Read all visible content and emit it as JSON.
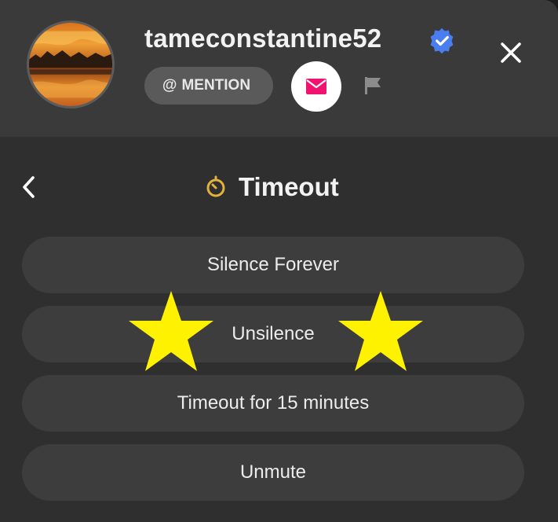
{
  "profile": {
    "username": "tameconstantine52",
    "verified_icon": "verified-badge-icon",
    "avatar_icon": "avatar-image"
  },
  "actions": {
    "mention_symbol": "@",
    "mention_label": "MENTION",
    "mail_icon": "mail-icon",
    "flag_icon": "flag-icon",
    "close_icon": "close-icon"
  },
  "timeout_menu": {
    "back_icon": "chevron-left-icon",
    "title_icon": "timer-icon",
    "title": "Timeout",
    "options": [
      {
        "label": "Silence Forever"
      },
      {
        "label": "Unsilence"
      },
      {
        "label": "Timeout for 15 minutes"
      },
      {
        "label": "Unmute"
      }
    ]
  },
  "annotations": {
    "highlight_icon": "star-icon",
    "highlight_color": "#fff200"
  },
  "colors": {
    "panel_bg": "#2f2f2f",
    "header_bg": "#3a3a3a",
    "option_bg": "#3d3d3d",
    "mention_bg": "#5a5a5a",
    "verified": "#4a7df0",
    "mail_accent": "#f0136f",
    "timer_accent": "#e3b23c"
  }
}
